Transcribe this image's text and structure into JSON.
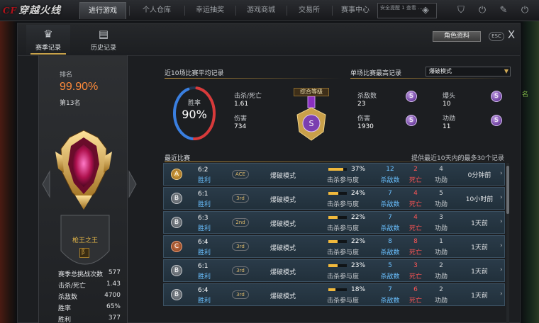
{
  "nav": {
    "logo_text": "穿越火线",
    "tabs": [
      "进行游戏",
      "个人仓库",
      "幸运抽奖",
      "游戏商城",
      "交易所",
      "赛事中心"
    ],
    "notice_text": "安全提醒 1 查看 ..."
  },
  "side_hint": "名",
  "panel": {
    "tabs": [
      {
        "label": "赛季记录",
        "icon": "trophy-icon",
        "active": true
      },
      {
        "label": "历史记录",
        "icon": "history-icon",
        "active": false
      }
    ],
    "role_button": "角色资料",
    "esc_label": "ESC",
    "close_label": "X"
  },
  "profile": {
    "rank_label": "排名",
    "rank_percent": "99.90%",
    "rank_position": "第13名",
    "title_name": "枪王之王",
    "title_badge": "阝",
    "stats": [
      {
        "label": "赛季总挑战次数",
        "value": "577"
      },
      {
        "label": "击杀/死亡",
        "value": "1.43"
      },
      {
        "label": "杀敌数",
        "value": "4700"
      },
      {
        "label": "胜率",
        "value": "65%"
      },
      {
        "label": "胜利",
        "value": "377"
      }
    ]
  },
  "avg_section": {
    "title": "近10场比赛平均记录",
    "winrate_label": "胜率",
    "winrate_value": "90%",
    "winrate_fraction": 0.9,
    "kd_label": "击杀/死亡",
    "kd_value": "1.61",
    "damage_label": "伤害",
    "damage_value": "734",
    "medal_label": "综合等级",
    "medal_grade": "S"
  },
  "best_section": {
    "title": "单场比赛最高记录",
    "mode_selected": "爆破模式",
    "items": [
      {
        "label": "杀敌数",
        "value": "23",
        "grade": "S"
      },
      {
        "label": "爆头",
        "value": "10",
        "grade": "S"
      },
      {
        "label": "伤害",
        "value": "1930",
        "grade": "S"
      },
      {
        "label": "功勋",
        "value": "11",
        "grade": "S"
      }
    ]
  },
  "recent": {
    "title": "最近比赛",
    "note": "提供最近10天内的最多30个记录",
    "participation_label": "击杀参与度",
    "kills_label": "杀敌数",
    "deaths_label": "死亡",
    "assists_label": "功勋",
    "matches": [
      {
        "grade": "A",
        "score": "6:2",
        "result": "胜利",
        "place": "ACE",
        "mode": "爆破模式",
        "participation": "37%",
        "participation_fraction": 0.37,
        "kills": "12",
        "deaths": "2",
        "merit": "4",
        "time": "0分钟前"
      },
      {
        "grade": "B",
        "score": "6:1",
        "result": "胜利",
        "place": "3rd",
        "mode": "爆破模式",
        "participation": "24%",
        "participation_fraction": 0.24,
        "kills": "7",
        "deaths": "4",
        "merit": "5",
        "time": "10小时前"
      },
      {
        "grade": "B",
        "score": "6:3",
        "result": "胜利",
        "place": "2nd",
        "mode": "爆破模式",
        "participation": "22%",
        "participation_fraction": 0.22,
        "kills": "7",
        "deaths": "4",
        "merit": "3",
        "time": "1天前"
      },
      {
        "grade": "C",
        "score": "6:4",
        "result": "胜利",
        "place": "3rd",
        "mode": "爆破模式",
        "participation": "22%",
        "participation_fraction": 0.22,
        "kills": "8",
        "deaths": "8",
        "merit": "1",
        "time": "1天前"
      },
      {
        "grade": "B",
        "score": "6:1",
        "result": "胜利",
        "place": "3rd",
        "mode": "爆破模式",
        "participation": "23%",
        "participation_fraction": 0.23,
        "kills": "5",
        "deaths": "3",
        "merit": "2",
        "time": "1天前"
      },
      {
        "grade": "B",
        "score": "6:4",
        "result": "胜利",
        "place": "3rd",
        "mode": "爆破模式",
        "participation": "18%",
        "participation_fraction": 0.18,
        "kills": "7",
        "deaths": "6",
        "merit": "2",
        "time": "1天前"
      }
    ]
  },
  "colors": {
    "accent_orange": "#ff8a3a",
    "win_blue": "#6ac0ff",
    "death_red": "#ff5555",
    "gold": "#c8a24a",
    "row_bg": "#2a3b49"
  }
}
